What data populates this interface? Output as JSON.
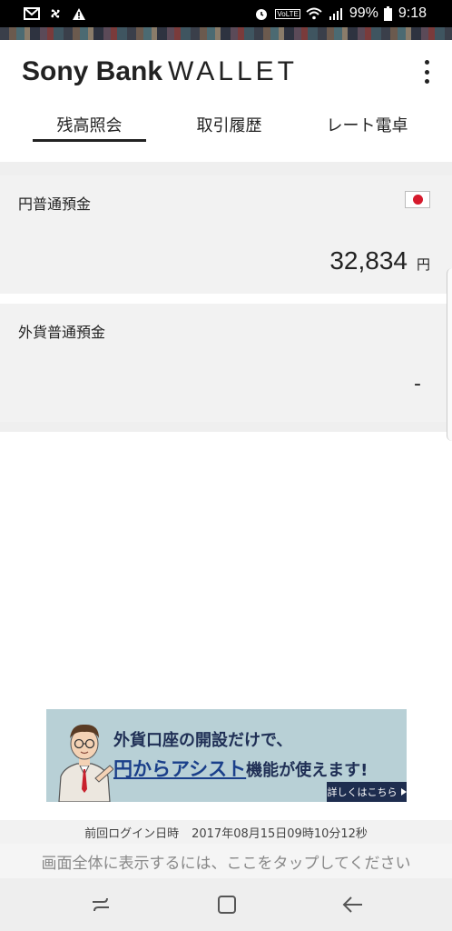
{
  "status_bar": {
    "battery": "99%",
    "time": "9:18",
    "volte_label": "VoLTE",
    "icons": [
      "mail-icon",
      "fan-icon",
      "warning-icon",
      "alarm-icon",
      "volte-icon",
      "wifi-icon",
      "signal-icon",
      "battery-icon"
    ]
  },
  "header": {
    "brand": "Sony Bank",
    "product": "WALLET",
    "menu_icon": "more-vertical-icon"
  },
  "tabs": [
    {
      "label": "残高照会",
      "active": true
    },
    {
      "label": "取引履歴",
      "active": false
    },
    {
      "label": "レート電卓",
      "active": false
    }
  ],
  "accounts": {
    "yen": {
      "title": "円普通預金",
      "flag_icon": "japan-flag-icon",
      "amount": "32,834",
      "unit": "円"
    },
    "foreign": {
      "title": "外貨普通預金",
      "amount": "-"
    }
  },
  "banner": {
    "line1": "外貨口座の開設だけで、",
    "line2_highlight": "円からアシスト",
    "line2_rest": "機能が使えます!",
    "cta": "詳しくはこちら"
  },
  "footer": {
    "last_login_label": "前回ログイン日時",
    "last_login_value": "2017年08月15日09時10分12秒",
    "fullscreen_hint": "画面全体に表示するには、ここをタップしてください"
  },
  "colors": {
    "accent": "#222222",
    "banner_bg": "#b8d0d6",
    "banner_text": "#1f2f55",
    "cta_bg": "#1e2d4f",
    "flag_red": "#d61a2c"
  }
}
